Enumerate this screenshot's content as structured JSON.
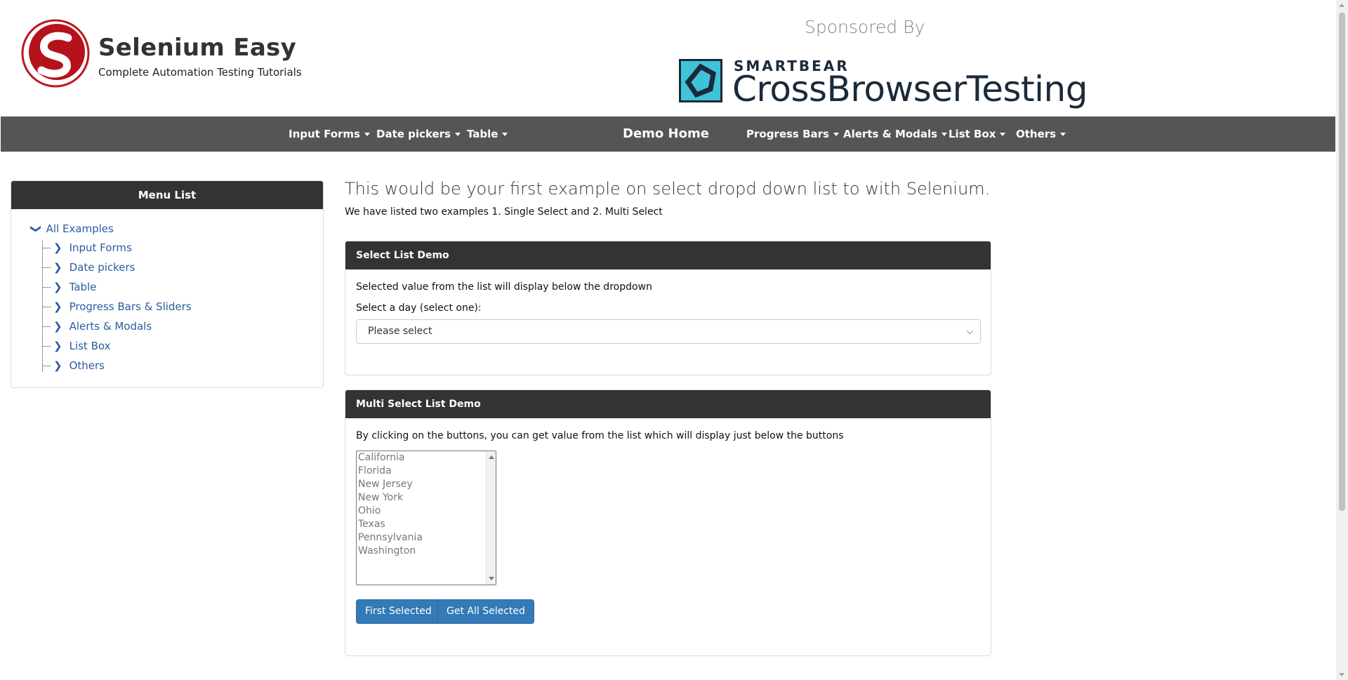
{
  "header": {
    "logo_title": "Selenium Easy",
    "logo_subtitle": "Complete Automation Testing Tutorials",
    "sponsored_label": "Sponsored By",
    "sponsor_brand": "SMARTBEAR",
    "sponsor_name": "CrossBrowserTesting"
  },
  "navbar": {
    "items": [
      "Input Forms",
      "Date pickers",
      "Table",
      "Demo Home",
      "Progress Bars",
      "Alerts & Modals",
      "List Box",
      "Others"
    ]
  },
  "sidebar": {
    "title": "Menu List",
    "root": "All Examples",
    "items": [
      "Input Forms",
      "Date pickers",
      "Table",
      "Progress Bars & Sliders",
      "Alerts & Modals",
      "List Box",
      "Others"
    ]
  },
  "main": {
    "heading": "This would be your first example on select dropd down list to with Selenium.",
    "subheading": "We have listed two examples 1. Single Select and 2. Multi Select",
    "select_panel": {
      "title": "Select List Demo",
      "description": "Selected value from the list will display below the dropdown",
      "label": "Select a day (select one):",
      "selected_value": "Please select"
    },
    "multi_panel": {
      "title": "Multi Select List Demo",
      "description": "By clicking on the buttons, you can get value from the list which will display just below the buttons",
      "options": [
        "California",
        "Florida",
        "New Jersey",
        "New York",
        "Ohio",
        "Texas",
        "Pennsylvania",
        "Washington"
      ],
      "button_first": "First Selected",
      "button_all": "Get All Selected"
    }
  },
  "colors": {
    "navbar_bg": "#555555",
    "panel_head_bg": "#333333",
    "link": "#2a5d9f",
    "button": "#337ab7",
    "logo_red": "#c0161d",
    "sponsor_teal": "#40c3d6"
  }
}
